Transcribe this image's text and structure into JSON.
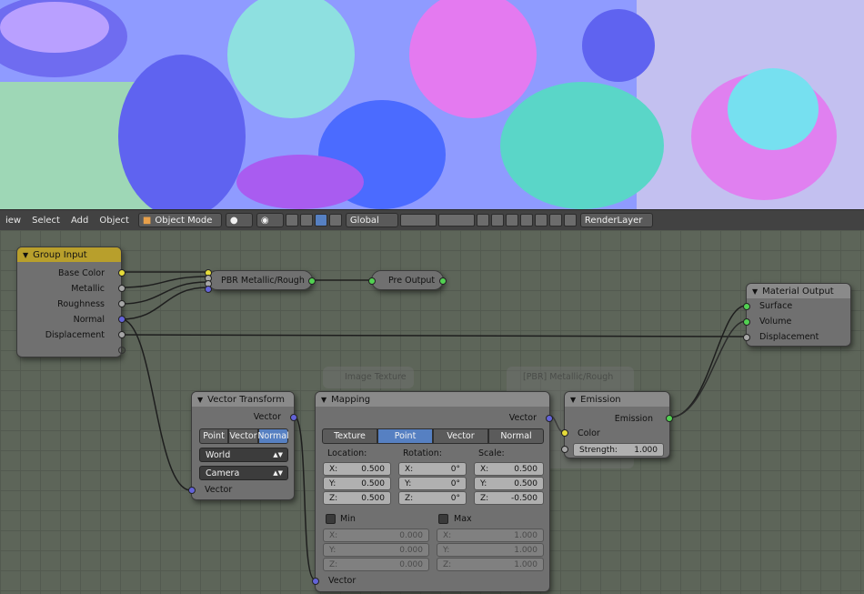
{
  "header": {
    "menus": [
      "iew",
      "Select",
      "Add",
      "Object"
    ],
    "mode": "Object Mode",
    "orientation": "Global",
    "render_layer": "RenderLayer"
  },
  "nodes": {
    "group_input": {
      "title": "Group Input",
      "outputs": [
        "Base Color",
        "Metallic",
        "Roughness",
        "Normal",
        "Displacement"
      ]
    },
    "pbr": {
      "title": "PBR Metallic/Rough"
    },
    "pre_output": {
      "title": "Pre Output"
    },
    "material_output": {
      "title": "Material Output",
      "inputs": [
        "Surface",
        "Volume",
        "Displacement"
      ]
    },
    "vector_transform": {
      "title": "Vector Transform",
      "output": "Vector",
      "types": [
        "Point",
        "Vector",
        "Normal"
      ],
      "from": "World",
      "to": "Camera",
      "input": "Vector"
    },
    "mapping": {
      "title": "Mapping",
      "output": "Vector",
      "types": [
        "Texture",
        "Point",
        "Vector",
        "Normal"
      ],
      "location_label": "Location:",
      "rotation_label": "Rotation:",
      "scale_label": "Scale:",
      "location": [
        {
          "a": "X:",
          "v": "0.500"
        },
        {
          "a": "Y:",
          "v": "0.500"
        },
        {
          "a": "Z:",
          "v": "0.500"
        }
      ],
      "rotation": [
        {
          "a": "X:",
          "v": "0°"
        },
        {
          "a": "Y:",
          "v": "0°"
        },
        {
          "a": "Z:",
          "v": "0°"
        }
      ],
      "scale": [
        {
          "a": "X:",
          "v": "0.500"
        },
        {
          "a": "Y:",
          "v": "0.500"
        },
        {
          "a": "Z:",
          "v": "-0.500"
        }
      ],
      "min_label": "Min",
      "max_label": "Max",
      "min": [
        {
          "a": "X:",
          "v": "0.000"
        },
        {
          "a": "Y:",
          "v": "0.000"
        },
        {
          "a": "Z:",
          "v": "0.000"
        }
      ],
      "max": [
        {
          "a": "X:",
          "v": "1.000"
        },
        {
          "a": "Y:",
          "v": "1.000"
        },
        {
          "a": "Z:",
          "v": "1.000"
        }
      ],
      "input": "Vector"
    },
    "emission": {
      "title": "Emission",
      "output": "Emission",
      "color": "Color",
      "strength_label": "Strength:",
      "strength": "1.000"
    },
    "ghost_image": {
      "title": "Image Texture"
    },
    "ghost_pbr": {
      "title": "[PBR] Metallic/Rough"
    }
  },
  "colors": {
    "accent": "#5680c2",
    "group_header": "#b89f2c",
    "socket_yellow": "#e6dc3a",
    "socket_green": "#52d152",
    "socket_purple": "#6363d8",
    "socket_gray": "#a6a6a6"
  }
}
